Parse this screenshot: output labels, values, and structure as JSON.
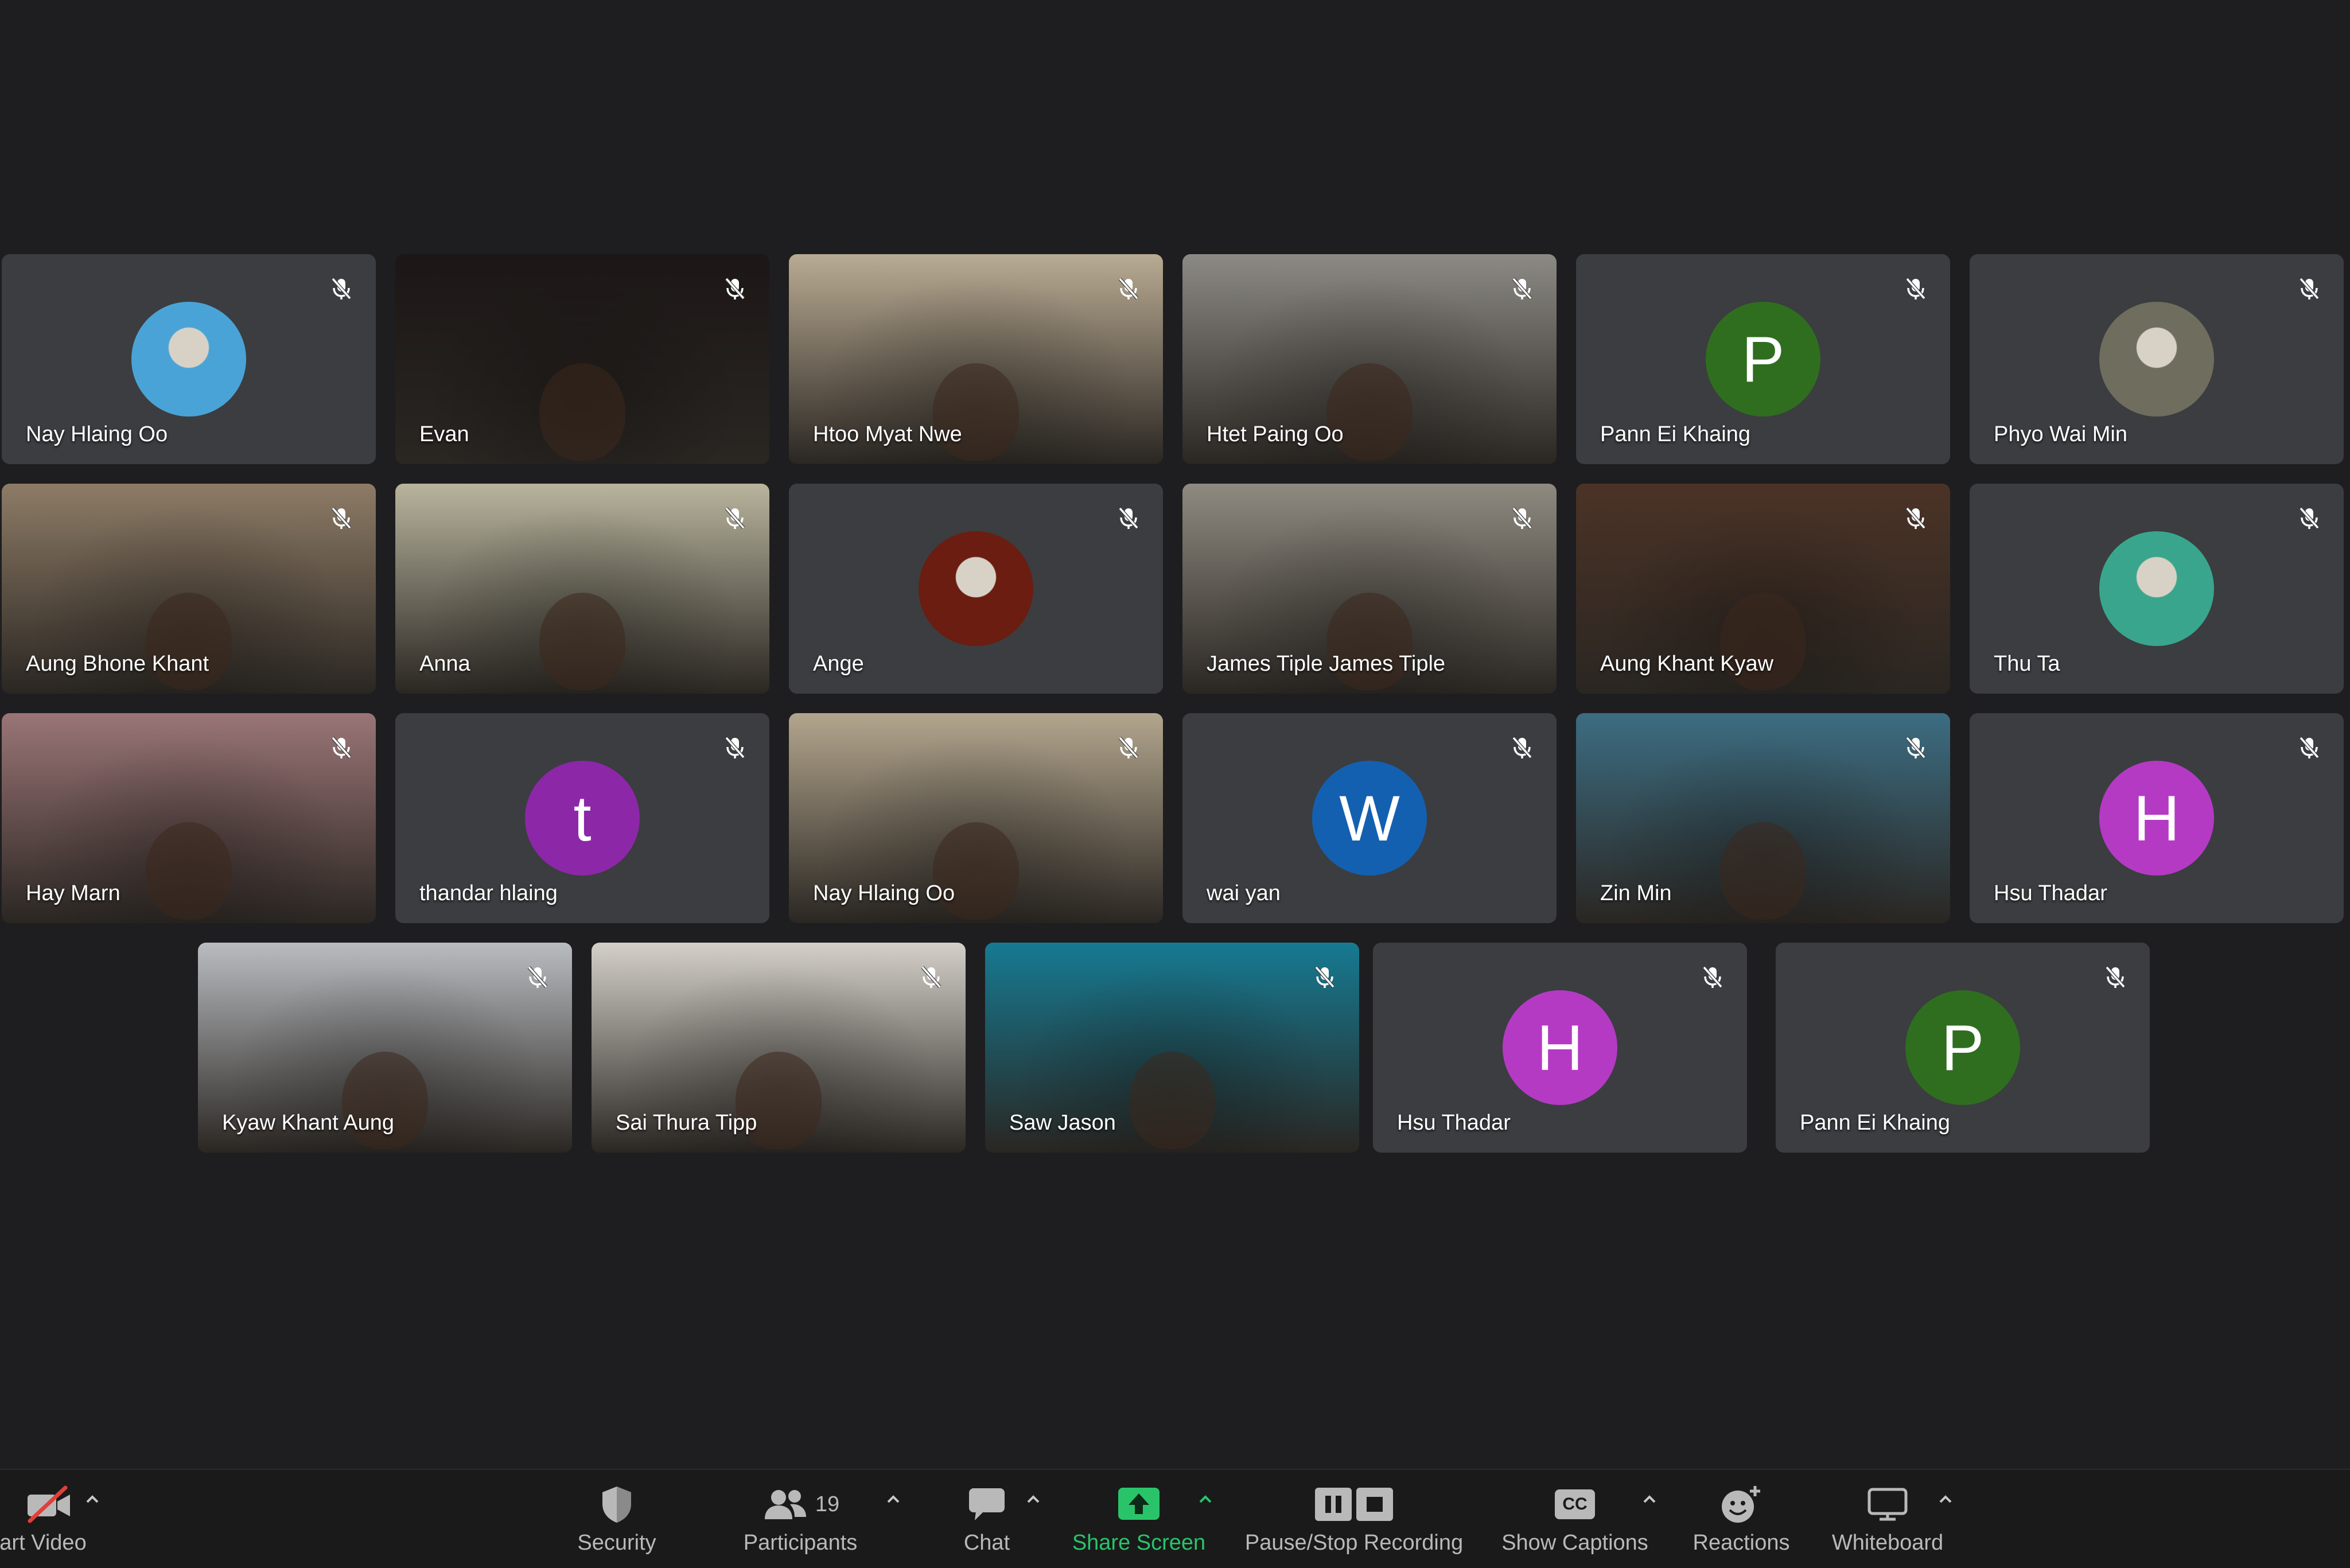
{
  "participants": [
    {
      "name": "Nay Hlaing Oo",
      "kind": "photo-avatar",
      "color": "#4aa3d6"
    },
    {
      "name": "Evan",
      "kind": "video",
      "color": "#1c1716"
    },
    {
      "name": "Htoo Myat Nwe",
      "kind": "video",
      "color": "#b9ab93"
    },
    {
      "name": "Htet Paing Oo",
      "kind": "video",
      "color": "#8c8a84"
    },
    {
      "name": "Pann Ei Khaing",
      "kind": "letter",
      "letter": "P",
      "color": "#2f6e1f"
    },
    {
      "name": "Phyo Wai Min",
      "kind": "photo-avatar",
      "color": "#6e6d5e"
    },
    {
      "name": "Aung Bhone Khant",
      "kind": "video",
      "color": "#8d7b66"
    },
    {
      "name": "Anna",
      "kind": "video",
      "color": "#b8b49d"
    },
    {
      "name": "Ange",
      "kind": "photo-avatar",
      "color": "#6a1d10"
    },
    {
      "name": "James Tiple James Tiple",
      "kind": "video",
      "color": "#8f8a80"
    },
    {
      "name": "Aung Khant Kyaw",
      "kind": "video",
      "color": "#4b3326"
    },
    {
      "name": "Thu Ta",
      "kind": "photo-avatar",
      "color": "#3aa58d"
    },
    {
      "name": "Hay Marn",
      "kind": "video",
      "color": "#9a7576"
    },
    {
      "name": "thandar hlaing",
      "kind": "letter",
      "letter": "t",
      "color": "#8c27a8"
    },
    {
      "name": "Nay Hlaing Oo",
      "kind": "video",
      "color": "#b3a68e"
    },
    {
      "name": "wai yan",
      "kind": "letter",
      "letter": "W",
      "color": "#1460b0"
    },
    {
      "name": "Zin Min",
      "kind": "video",
      "color": "#3c6d82"
    },
    {
      "name": "Hsu Thadar",
      "kind": "letter",
      "letter": "H",
      "color": "#b43ac4"
    },
    {
      "name": "Kyaw Khant Aung",
      "kind": "video",
      "color": "#b9bcc0"
    },
    {
      "name": "Sai Thura Tipp",
      "kind": "video",
      "color": "#d4d0c9"
    },
    {
      "name": "Saw Jason",
      "kind": "video",
      "color": "#167a92"
    },
    {
      "name": "Hsu Thadar",
      "kind": "letter",
      "letter": "H",
      "color": "#b43ac4"
    },
    {
      "name": "Pann Ei Khaing",
      "kind": "letter",
      "letter": "P",
      "color": "#2f6e1f"
    }
  ],
  "toolbar": {
    "start_video": "art Video",
    "security": "Security",
    "participants": "Participants",
    "participant_count": "19",
    "chat": "Chat",
    "share_screen": "Share Screen",
    "recording": "Pause/Stop Recording",
    "captions": "Show Captions",
    "captions_badge": "CC",
    "reactions": "Reactions",
    "whiteboard": "Whiteboard"
  },
  "colors": {
    "background": "#1e1e20",
    "tile": "#3b3d40",
    "share_green": "#29c46a"
  }
}
